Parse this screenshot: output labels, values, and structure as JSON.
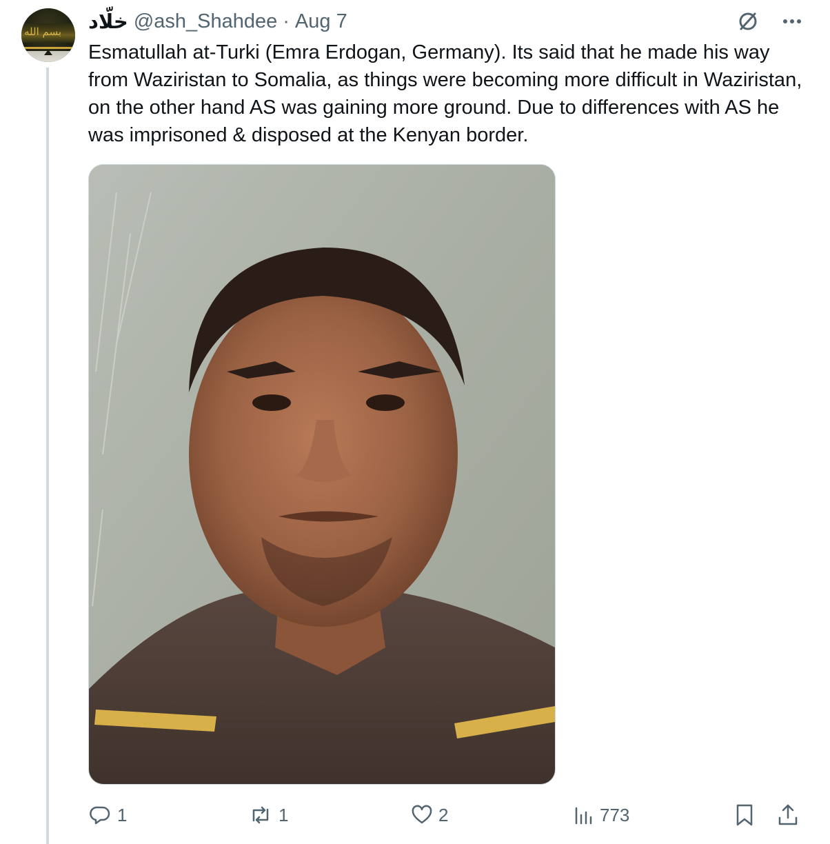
{
  "tweet": {
    "display_name": "خلّاد",
    "handle": "@ash_Shahdee",
    "separator": "·",
    "date": "Aug 7",
    "text": "Esmatullah at-Turki (Emra Erdogan, Germany). Its said that he made his way from Waziristan to Somalia, as things were becoming more difficult in Waziristan, on the other hand AS was gaining more ground. Due to differences with AS he was imprisoned & disposed at the Kenyan border.",
    "media": {
      "kind": "photo",
      "subject": "portrait photo of a young man"
    }
  },
  "header_icons": {
    "grok_icon": "slashed-circle-icon",
    "more_icon": "more-horizontal-icon"
  },
  "actions": {
    "replies": "1",
    "reposts": "1",
    "likes": "2",
    "views": "773"
  },
  "colors": {
    "text": "#0f1419",
    "muted": "#536471",
    "thread_line": "#cfd9de",
    "border": "#cfd9de"
  }
}
